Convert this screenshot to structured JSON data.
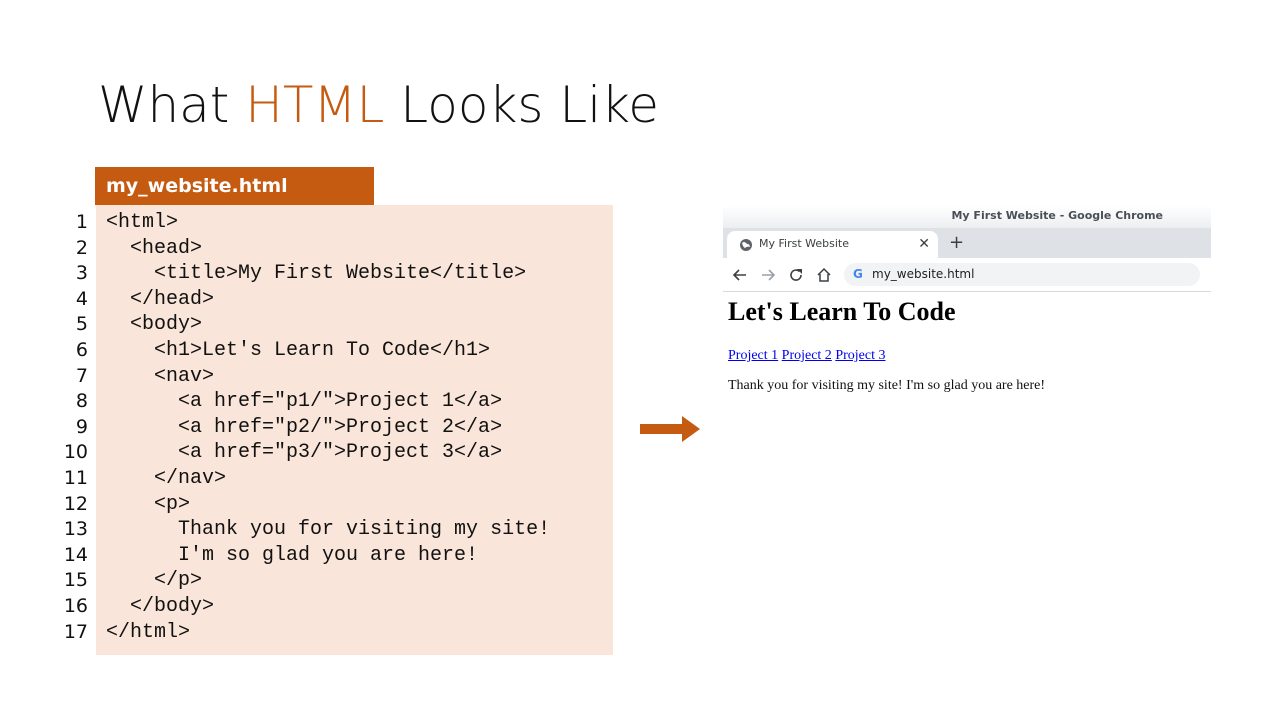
{
  "slide": {
    "title_prefix": "What ",
    "title_accent": "HTML",
    "title_suffix": " Looks Like",
    "accent_color": "#c55a11"
  },
  "code_file": {
    "filename": "my_website.html",
    "line_numbers": [
      "1",
      "2",
      "3",
      "4",
      "5",
      "6",
      "7",
      "8",
      "9",
      "10",
      "11",
      "12",
      "13",
      "14",
      "15",
      "16",
      "17"
    ],
    "lines": [
      "<html>",
      "  <head>",
      "    <title>My First Website</title>",
      "  </head>",
      "  <body>",
      "    <h1>Let's Learn To Code</h1>",
      "    <nav>",
      "      <a href=\"p1/\">Project 1</a>",
      "      <a href=\"p2/\">Project 2</a>",
      "      <a href=\"p3/\">Project 3</a>",
      "    </nav>",
      "    <p>",
      "      Thank you for visiting my site!",
      "      I'm so glad you are here!",
      "    </p>",
      "  </body>",
      "</html>"
    ]
  },
  "arrow_icon": "right-arrow",
  "browser": {
    "window_title": "My First Website - Google Chrome",
    "tab_title": "My First Website",
    "tab_close": "✕",
    "new_tab": "+",
    "google_logo": "G",
    "url": "my_website.html",
    "icons": [
      "back-arrow-icon",
      "forward-arrow-icon",
      "reload-icon",
      "home-icon",
      "globe-icon"
    ],
    "page": {
      "heading": "Let's Learn To Code",
      "links": [
        "Project 1",
        "Project 2",
        "Project 3"
      ],
      "paragraph": "Thank you for visiting my site! I'm so glad you are here!"
    }
  }
}
